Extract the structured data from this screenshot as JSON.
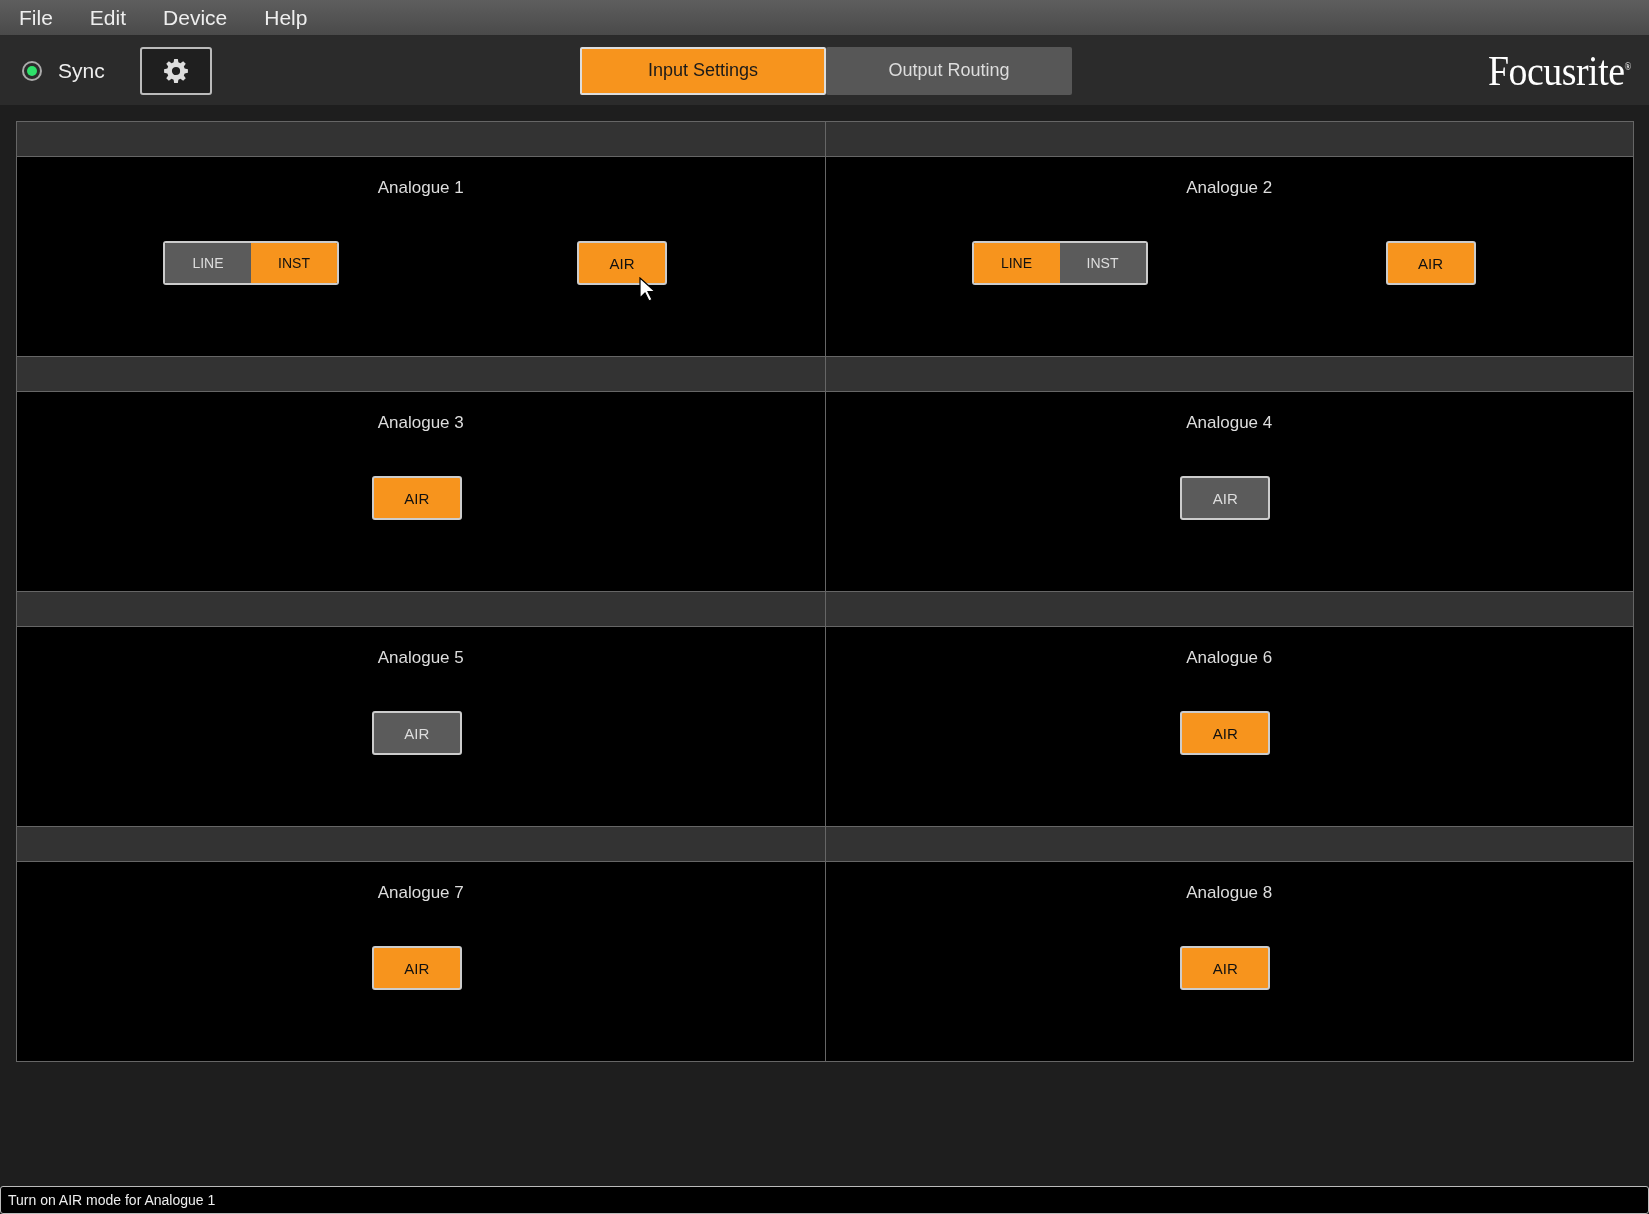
{
  "menu": [
    "File",
    "Edit",
    "Device",
    "Help"
  ],
  "sync": {
    "label": "Sync",
    "on": true
  },
  "tabs": [
    {
      "label": "Input Settings",
      "selected": true
    },
    {
      "label": "Output Routing",
      "selected": false
    }
  ],
  "logo": "Focusrite$^{®}$",
  "channels": [
    {
      "kind": "input-and-air",
      "name": "Analogue 1",
      "modes": [
        {
          "label": "LINE",
          "selected": false
        },
        {
          "label": "INST",
          "selected": true
        }
      ],
      "air": {
        "label": "AIR",
        "on": true
      },
      "pointer": true
    },
    {
      "kind": "input-and-air",
      "name": "Analogue 2",
      "modes": [
        {
          "label": "LINE",
          "selected": true
        },
        {
          "label": "INST",
          "selected": false
        }
      ],
      "air": {
        "label": "AIR",
        "on": true
      }
    },
    {
      "kind": "air-only",
      "name": "Analogue 3",
      "air": {
        "label": "AIR",
        "on": true
      }
    },
    {
      "kind": "air-only",
      "name": "Analogue 4",
      "air": {
        "label": "AIR",
        "on": false
      }
    },
    {
      "kind": "air-only",
      "name": "Analogue 5",
      "air": {
        "label": "AIR",
        "on": false
      }
    },
    {
      "kind": "air-only",
      "name": "Analogue 6",
      "air": {
        "label": "AIR",
        "on": true
      }
    },
    {
      "kind": "air-only",
      "name": "Analogue 7",
      "air": {
        "label": "AIR",
        "on": true
      }
    },
    {
      "kind": "air-only",
      "name": "Analogue 8",
      "air": {
        "label": "AIR",
        "on": true
      }
    }
  ],
  "status_bar": "Turn on AIR mode for Analogue 1"
}
